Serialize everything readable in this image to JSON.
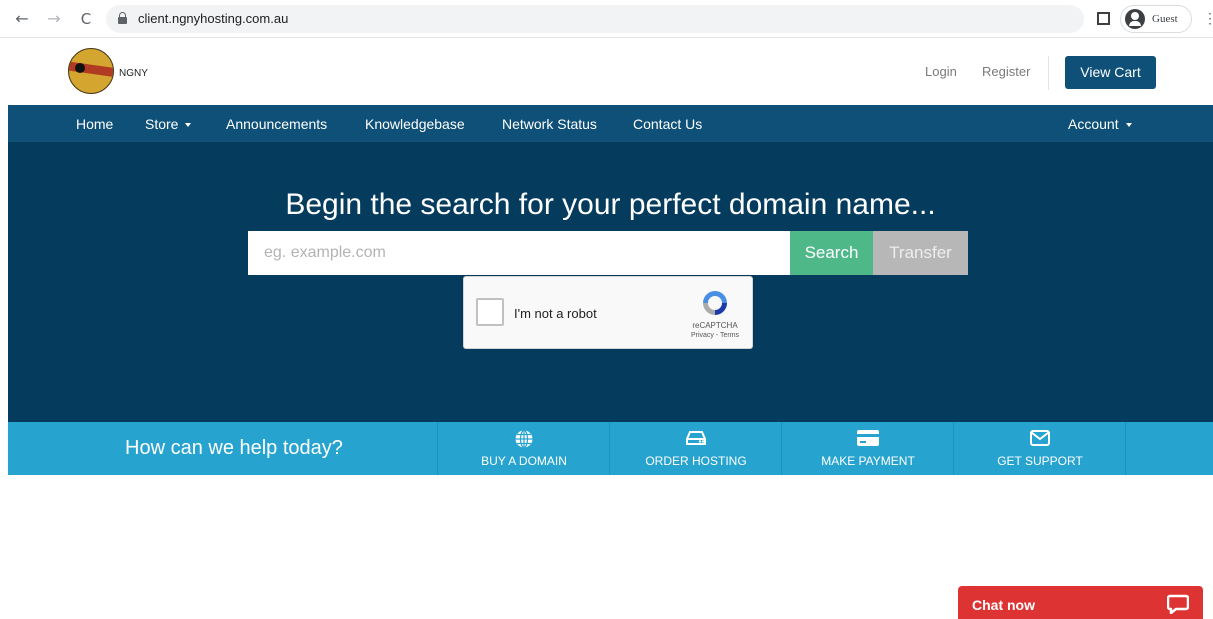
{
  "browser": {
    "url": "client.ngnyhosting.com.au",
    "profile_label": "Guest",
    "back_glyph": "←",
    "forward_glyph": "→",
    "reload_glyph": "C",
    "menu_glyph": "⋮"
  },
  "header": {
    "logo_text": "NGNY",
    "login_label": "Login",
    "register_label": "Register",
    "view_cart_label": "View Cart"
  },
  "nav": {
    "home": "Home",
    "store": "Store",
    "announcements": "Announcements",
    "knowledgebase": "Knowledgebase",
    "network_status": "Network Status",
    "contact_us": "Contact Us",
    "account": "Account"
  },
  "hero": {
    "title": "Begin the search for your perfect domain name...",
    "search_placeholder": "eg. example.com",
    "search_label": "Search",
    "transfer_label": "Transfer"
  },
  "recaptcha": {
    "label": "I'm not a robot",
    "brand": "reCAPTCHA",
    "terms": "Privacy - Terms"
  },
  "help": {
    "title": "How can we help today?",
    "items": [
      {
        "label": "BUY A DOMAIN",
        "icon": "globe-icon"
      },
      {
        "label": "ORDER HOSTING",
        "icon": "hard-drive-icon"
      },
      {
        "label": "MAKE PAYMENT",
        "icon": "credit-card-icon"
      },
      {
        "label": "GET SUPPORT",
        "icon": "envelope-icon"
      }
    ]
  },
  "chat": {
    "label": "Chat now",
    "icon": "speech-bubble-icon"
  },
  "colors": {
    "nav": "#0e5077",
    "hero": "#053c5e",
    "help_bar": "#26a3cf",
    "search": "#4fb889",
    "transfer": "#b7b7b7",
    "chat": "#dd3333"
  }
}
